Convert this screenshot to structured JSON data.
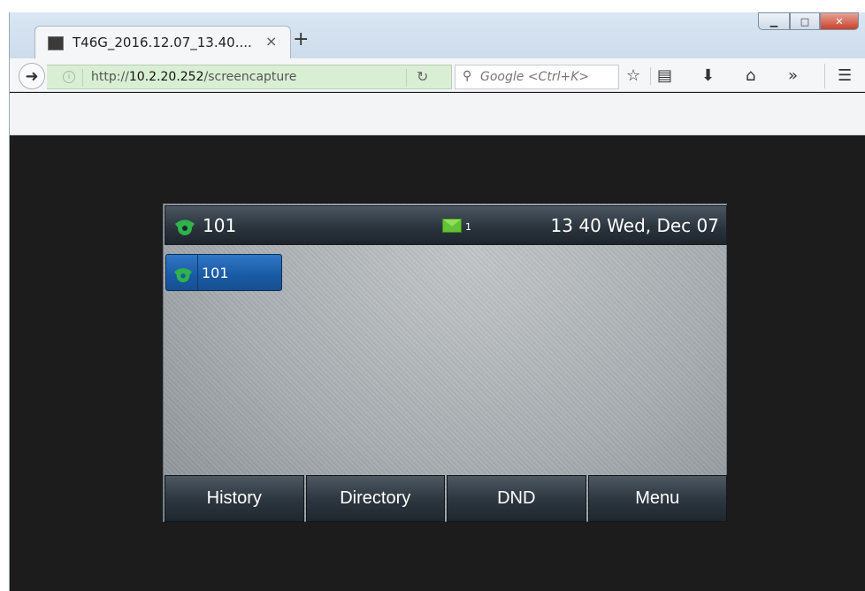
{
  "browser": {
    "tab_title": "T46G_2016.12.07_13.40....",
    "tab_close": "×",
    "new_tab": "+",
    "win_minimize": "▁",
    "win_maximize": "□",
    "win_close": "✕",
    "url_scheme": "http://",
    "url_host": "10.2.20.252",
    "url_path": "/screencapture",
    "search_placeholder": "Google <Ctrl+K>",
    "icons": {
      "back": "back-arrow-icon",
      "info": "info-icon",
      "reload": "reload-icon",
      "search": "search-icon",
      "bookmark": "star-icon",
      "library": "library-icon",
      "download": "download-icon",
      "home": "home-icon",
      "overflow": "chevrons-right-icon",
      "menu": "hamburger-menu-icon"
    }
  },
  "phone": {
    "status": {
      "account": "101",
      "message_count": "1",
      "datetime": "13 40 Wed, Dec 07"
    },
    "line_keys": [
      {
        "label": "101"
      }
    ],
    "softkeys": [
      "History",
      "Directory",
      "DND",
      "Menu"
    ],
    "colors": {
      "line_key_bg": "#1a5aa4",
      "phone_icon": "#2fb34a",
      "mail_icon": "#63c236"
    }
  }
}
